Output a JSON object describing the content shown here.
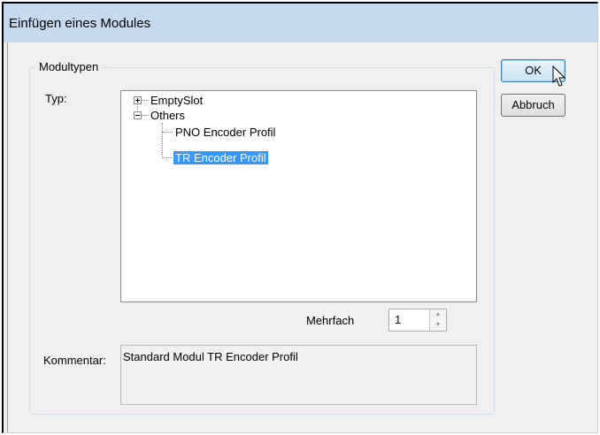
{
  "window": {
    "title": "Einfügen eines Modules"
  },
  "group": {
    "legend": "Modultypen"
  },
  "type_label": "Typ:",
  "tree": {
    "items": [
      {
        "label": "EmptySlot",
        "expander": "+"
      },
      {
        "label": "Others",
        "expander": "−"
      },
      {
        "label": "PNO Encoder Profil"
      },
      {
        "label": "TR Encoder Profil",
        "selected": true
      }
    ]
  },
  "multiple": {
    "label": "Mehrfach",
    "value": "1"
  },
  "comment": {
    "label": "Kommentar:",
    "text": "Standard Modul TR Encoder Profil"
  },
  "buttons": {
    "ok": "OK",
    "cancel": "Abbruch"
  },
  "colors": {
    "selection": "#3399ff",
    "titlebar": "#c5d9ef"
  }
}
